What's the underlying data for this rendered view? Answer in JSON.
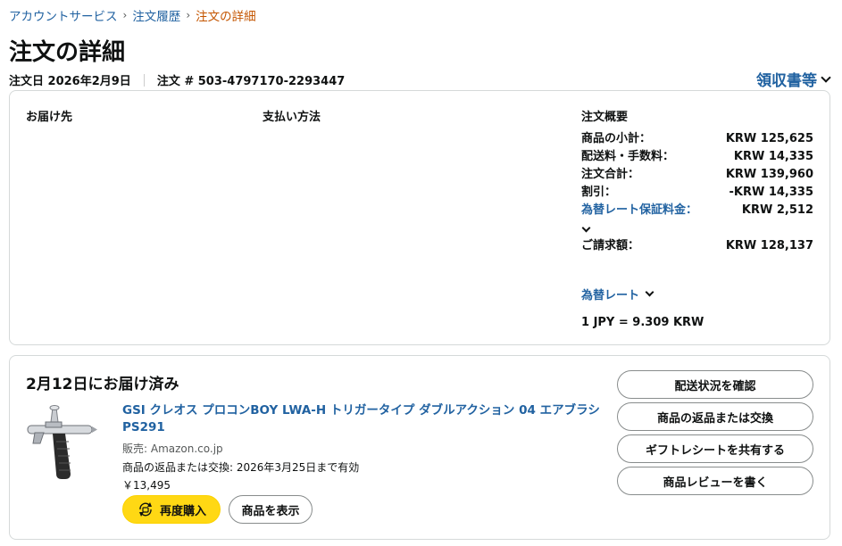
{
  "breadcrumb": {
    "items": [
      "アカウントサービス",
      "注文履歴"
    ],
    "current": "注文の詳細",
    "separator": "›"
  },
  "page": {
    "title": "注文の詳細"
  },
  "order": {
    "date": "注文日 2026年2月9日",
    "number": "注文 # 503-4797170-2293447"
  },
  "receipt": {
    "label": "領収書等"
  },
  "info": {
    "shipping_label": "お届け先",
    "payment_label": "支払い方法",
    "summary_label": "注文概要"
  },
  "summary": {
    "rows": [
      {
        "label": "商品の小計：",
        "value": "KRW 125,625"
      },
      {
        "label": "配送料・手数料：",
        "value": "KRW 14,335"
      },
      {
        "label": "注文合計：",
        "value": "KRW 139,960"
      },
      {
        "label": "割引：",
        "value": "-KRW 14,335"
      }
    ],
    "fx_fee": {
      "label": "為替レート保証料金：",
      "value": "KRW 2,512"
    },
    "grand_total": {
      "label": "ご請求額：",
      "value": "KRW 128,137"
    },
    "fx_toggle": "為替レート",
    "fx_rate": "1 JPY = 9.309 KRW"
  },
  "shipment": {
    "status": "2月12日にお届け済み",
    "product": {
      "title": "GSI クレオス プロコンBOY LWA-H トリガータイプ ダブルアクション 04 エアブラシ PS291",
      "seller": "販売: Amazon.co.jp",
      "return_note": "商品の返品または交換: 2026年3月25日まで有効",
      "price": "￥13,495"
    },
    "buy_again": "再度購入",
    "view_item": "商品を表示",
    "actions": [
      "配送状況を確認",
      "商品の返品または交換",
      "ギフトレシートを共有する",
      "商品レビューを書く"
    ]
  },
  "colors": {
    "link": "#2162a1",
    "current_crumb": "#c45500",
    "buy_again": "#ffd814",
    "border": "#d5d9d9"
  }
}
